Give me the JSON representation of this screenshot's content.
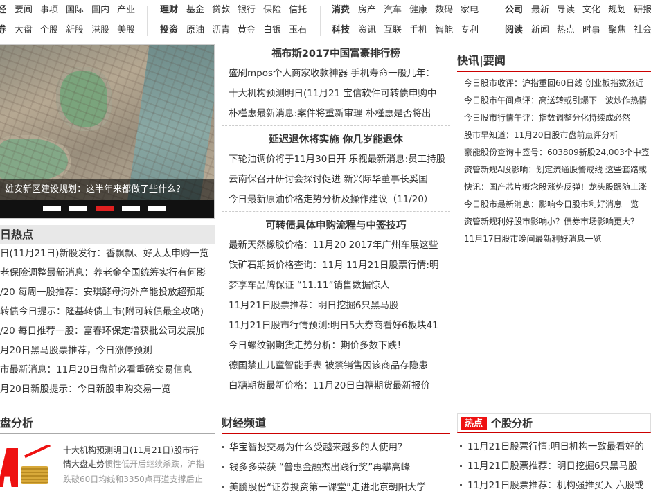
{
  "nav": {
    "row1_g1": [
      "经",
      "要闻",
      "事项",
      "国际",
      "国内",
      "产业"
    ],
    "row1_g2": [
      "理财",
      "基金",
      "贷款",
      "银行",
      "保险",
      "信托"
    ],
    "row1_g3": [
      "消费",
      "房产",
      "汽车",
      "健康",
      "数码",
      "家电"
    ],
    "row1_g4": [
      "公司",
      "最新",
      "导读",
      "文化",
      "规划",
      "研报"
    ],
    "row2_g1": [
      "券",
      "大盘",
      "个股",
      "新股",
      "港股",
      "美股"
    ],
    "row2_g2": [
      "投资",
      "原油",
      "沥青",
      "黄金",
      "白银",
      "玉石"
    ],
    "row2_g3": [
      "科技",
      "资讯",
      "互联",
      "手机",
      "智能",
      "专利"
    ],
    "row2_g4": [
      "阅读",
      "新闻",
      "热点",
      "时事",
      "聚焦",
      "社会"
    ]
  },
  "carousel": {
    "caption": "雄安新区建设规划：这半年来都做了些什么？",
    "dot_count": 5,
    "active_dot": 2
  },
  "hot": {
    "title": "日热点",
    "items": [
      "日(11月21日)新股发行：香飘飘、好太太申购一览",
      "老保险调整最新消息：养老金全国统筹实行有何影",
      "/20 每周一股推荐：安琪酵母海外产能投放超预期",
      "转债今日提示：隆基转债上市(附可转债最全攻略)",
      "/20 每日推荐一股：富春环保定增获批公司发展加",
      "月20日黑马股票推荐，今日涨停预测",
      "市最新消息：11月20日盘前必看重磅交易信息",
      "月20日新股提示：今日新股申购交易一览"
    ]
  },
  "analysis": {
    "title": "盘分析",
    "headline": "十大机构预测明日(11月21日)股市行",
    "overlay_a": "情大盘走势",
    "summary": "惯性低开后继续杀跌，沪指",
    "summary2": "跌破60日均线和3350点再道支撑后止"
  },
  "middle": {
    "blocks": [
      {
        "title": "福布斯2017中国富豪排行榜",
        "lines": [
          "盛刷mpos个人商家收款神器 手机寿命一般几年：",
          "十大机构预测明日(11月21 宝信软件可转债申购中",
          "朴槿惠最新消息:案件将重新审理 朴槿惠是否将出"
        ]
      },
      {
        "title": "延迟退休将实施 你几岁能退休",
        "lines": [
          "下轮油调价将于11月30日开 乐视最新消息:员工持股",
          "云南保召开研讨会探讨促进 新兴际华董事长奚国",
          "今日最新原油价格走势分析及操作建议（11/20）"
        ]
      },
      {
        "title": "可转债具体申购流程与中签技巧",
        "lines": [
          "最新天然橡胶价格：11月20 2017年广州车展这些",
          "铁矿石期货价格查询：11月 11月21日股票行情:明",
          "梦享车品牌保证 “11.11”销售数据惊人",
          "11月21日股票推荐：明日挖掘6只黑马股",
          "11月21日股市行情预测:明日5大券商看好6板块41",
          "今日螺纹钢期货走势分析：期价多数下跌！",
          "德国禁止儿童智能手表 被禁销售因该商品存隐患",
          "白糖期货最新价格：11月20日白糖期货最新报价"
        ]
      }
    ]
  },
  "finance": {
    "title": "财经频道",
    "items": [
      "华宝智投交易为什么受越来越多的人使用？",
      "钱多多荣获 “普惠金融杰出践行奖”再攀高峰",
      "美鹏股份“证券投资第一课堂”走进北京朝阳大学"
    ]
  },
  "flash": {
    "title": "快讯|要闻",
    "items": [
      "今日股市收评：沪指重回60日线 创业板指数涨近",
      "今日股市午间点评：高送转或引爆下一波炒作热情",
      "今日股市行情午评：指数调整分化持续成必然",
      "股市早知道：11月20日股市盘前点评分析",
      "豪能股份查询中签号：603809新股24,003个中签",
      "资管新规A股影响：划定流通股警戒线 这些套路或",
      "快讯：国产芯片概念股涨势反弹！龙头股跟随上涨",
      "今日股市最新消息：影响今日股市利好消息一览",
      "资管新规利好股市影响小？债券市场影响更大？",
      "11月17日股市晚间最新利好消息一览"
    ]
  },
  "stock": {
    "badge": "热点",
    "title": "个股分析",
    "items": [
      "11月21日股票行情:明日机构一致最看好的",
      "11月21日股票推荐：明日挖掘6只黑马股",
      "11月21日股票推荐：机构强推买入 六股或"
    ]
  }
}
